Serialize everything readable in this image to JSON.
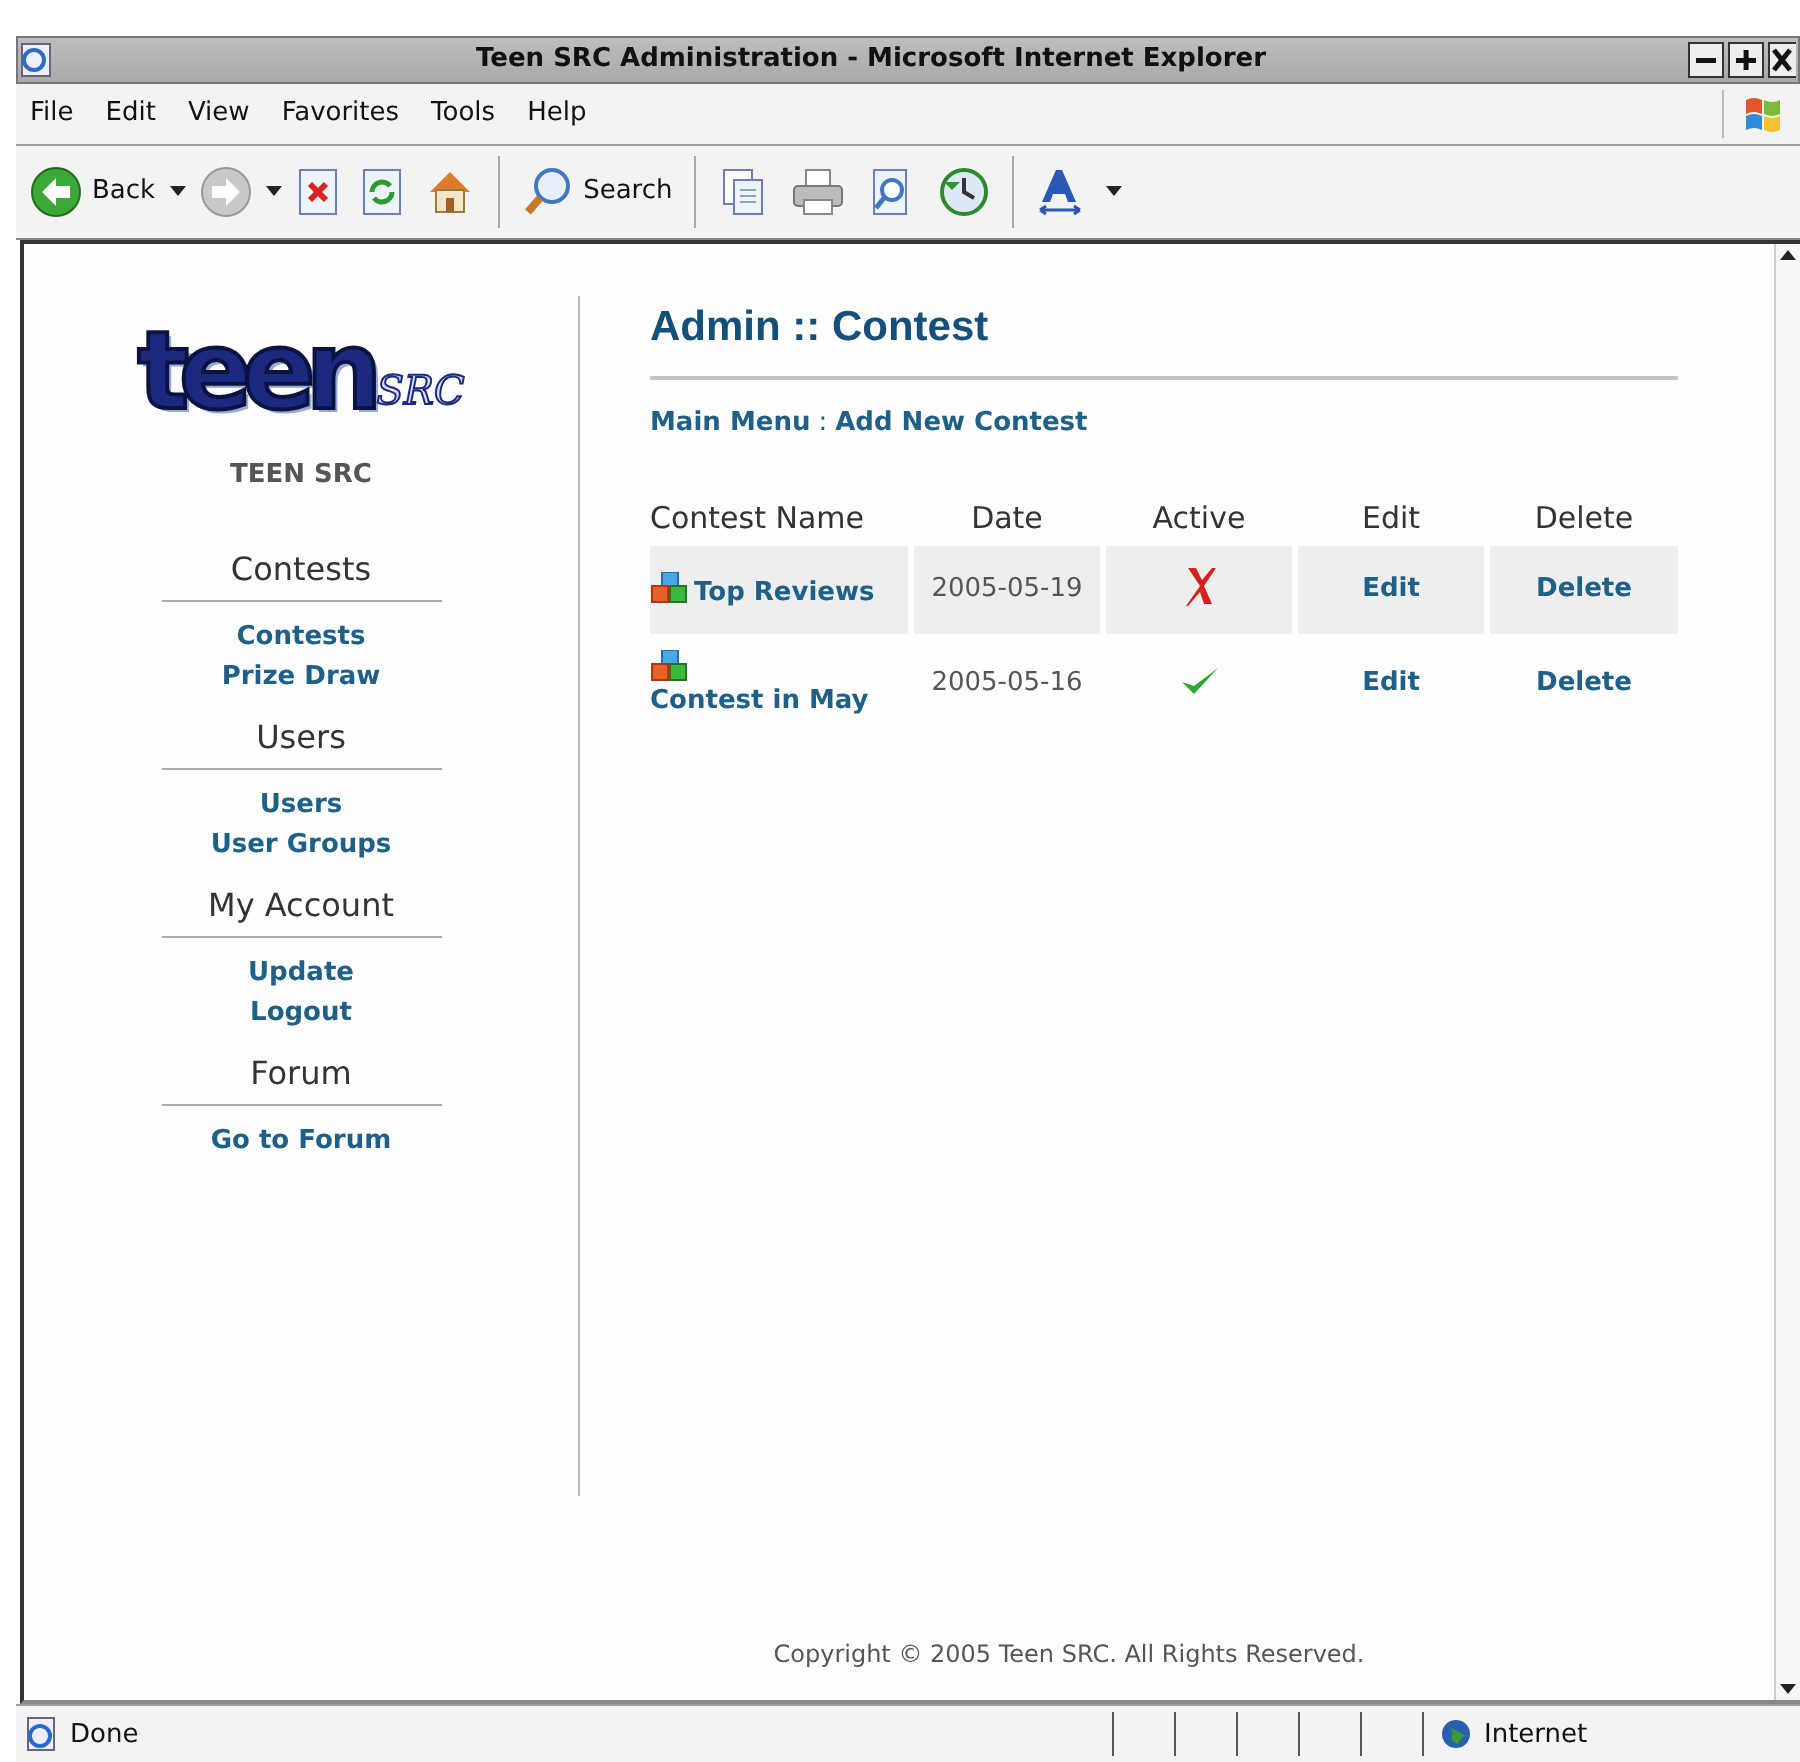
{
  "window": {
    "title": "Teen SRC Administration - Microsoft Internet Explorer"
  },
  "menu": [
    "File",
    "Edit",
    "View",
    "Favorites",
    "Tools",
    "Help"
  ],
  "toolbar": {
    "back": "Back",
    "search": "Search"
  },
  "sidebar": {
    "logo": {
      "main": "teen",
      "sub": "SRC"
    },
    "site_name": "TEEN SRC",
    "sections": [
      {
        "heading": "Contests",
        "links": [
          "Contests",
          "Prize Draw"
        ]
      },
      {
        "heading": "Users",
        "links": [
          "Users",
          "User Groups"
        ]
      },
      {
        "heading": "My Account",
        "links": [
          "Update",
          "Logout"
        ]
      },
      {
        "heading": "Forum",
        "links": [
          "Go to Forum"
        ]
      }
    ]
  },
  "page": {
    "title": "Admin :: Contest",
    "nav": [
      "Main Menu",
      "Add New Contest"
    ],
    "nav_separator": ":"
  },
  "table": {
    "columns": [
      "Contest Name",
      "Date",
      "Active",
      "Edit",
      "Delete"
    ],
    "rows": [
      {
        "name": "Top Reviews",
        "date": "2005-05-19",
        "active": false,
        "edit": "Edit",
        "delete": "Delete"
      },
      {
        "name": "Contest in May",
        "date": "2005-05-16",
        "active": true,
        "edit": "Edit",
        "delete": "Delete"
      }
    ]
  },
  "footer": "Copyright © 2005 Teen SRC. All Rights Reserved.",
  "status_bar": {
    "text": "Done",
    "zone": "Internet"
  }
}
